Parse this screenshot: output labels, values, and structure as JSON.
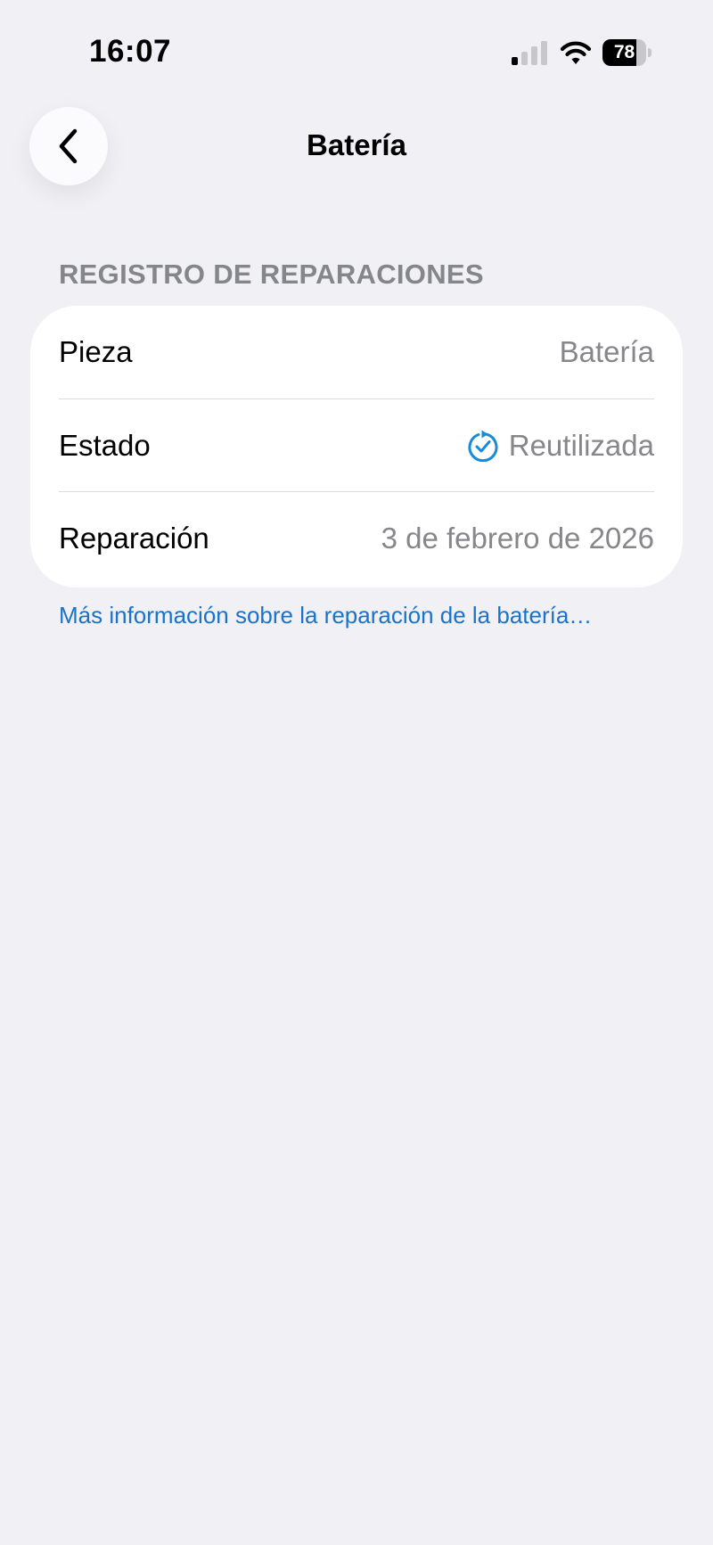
{
  "status_bar": {
    "time": "16:07",
    "battery_level": "78",
    "battery_fraction": 0.78,
    "signal_bars_active": 1,
    "signal_bars_total": 4
  },
  "nav": {
    "back_icon": "chevron-left-icon",
    "title": "Batería"
  },
  "section": {
    "header": "REGISTRO DE REPARACIONES"
  },
  "rows": [
    {
      "label": "Pieza",
      "value": "Batería"
    },
    {
      "label": "Estado",
      "value": "Reutilizada",
      "icon": "checkmark-refresh-icon",
      "icon_color": "#1a8bd6"
    },
    {
      "label": "Reparación",
      "value": "3 de febrero de 2026"
    }
  ],
  "link": {
    "text": "Más información sobre la reparación de la batería…"
  },
  "colors": {
    "background": "#f0f0f5",
    "link": "#1a73c8",
    "secondary_text": "#86868b"
  }
}
